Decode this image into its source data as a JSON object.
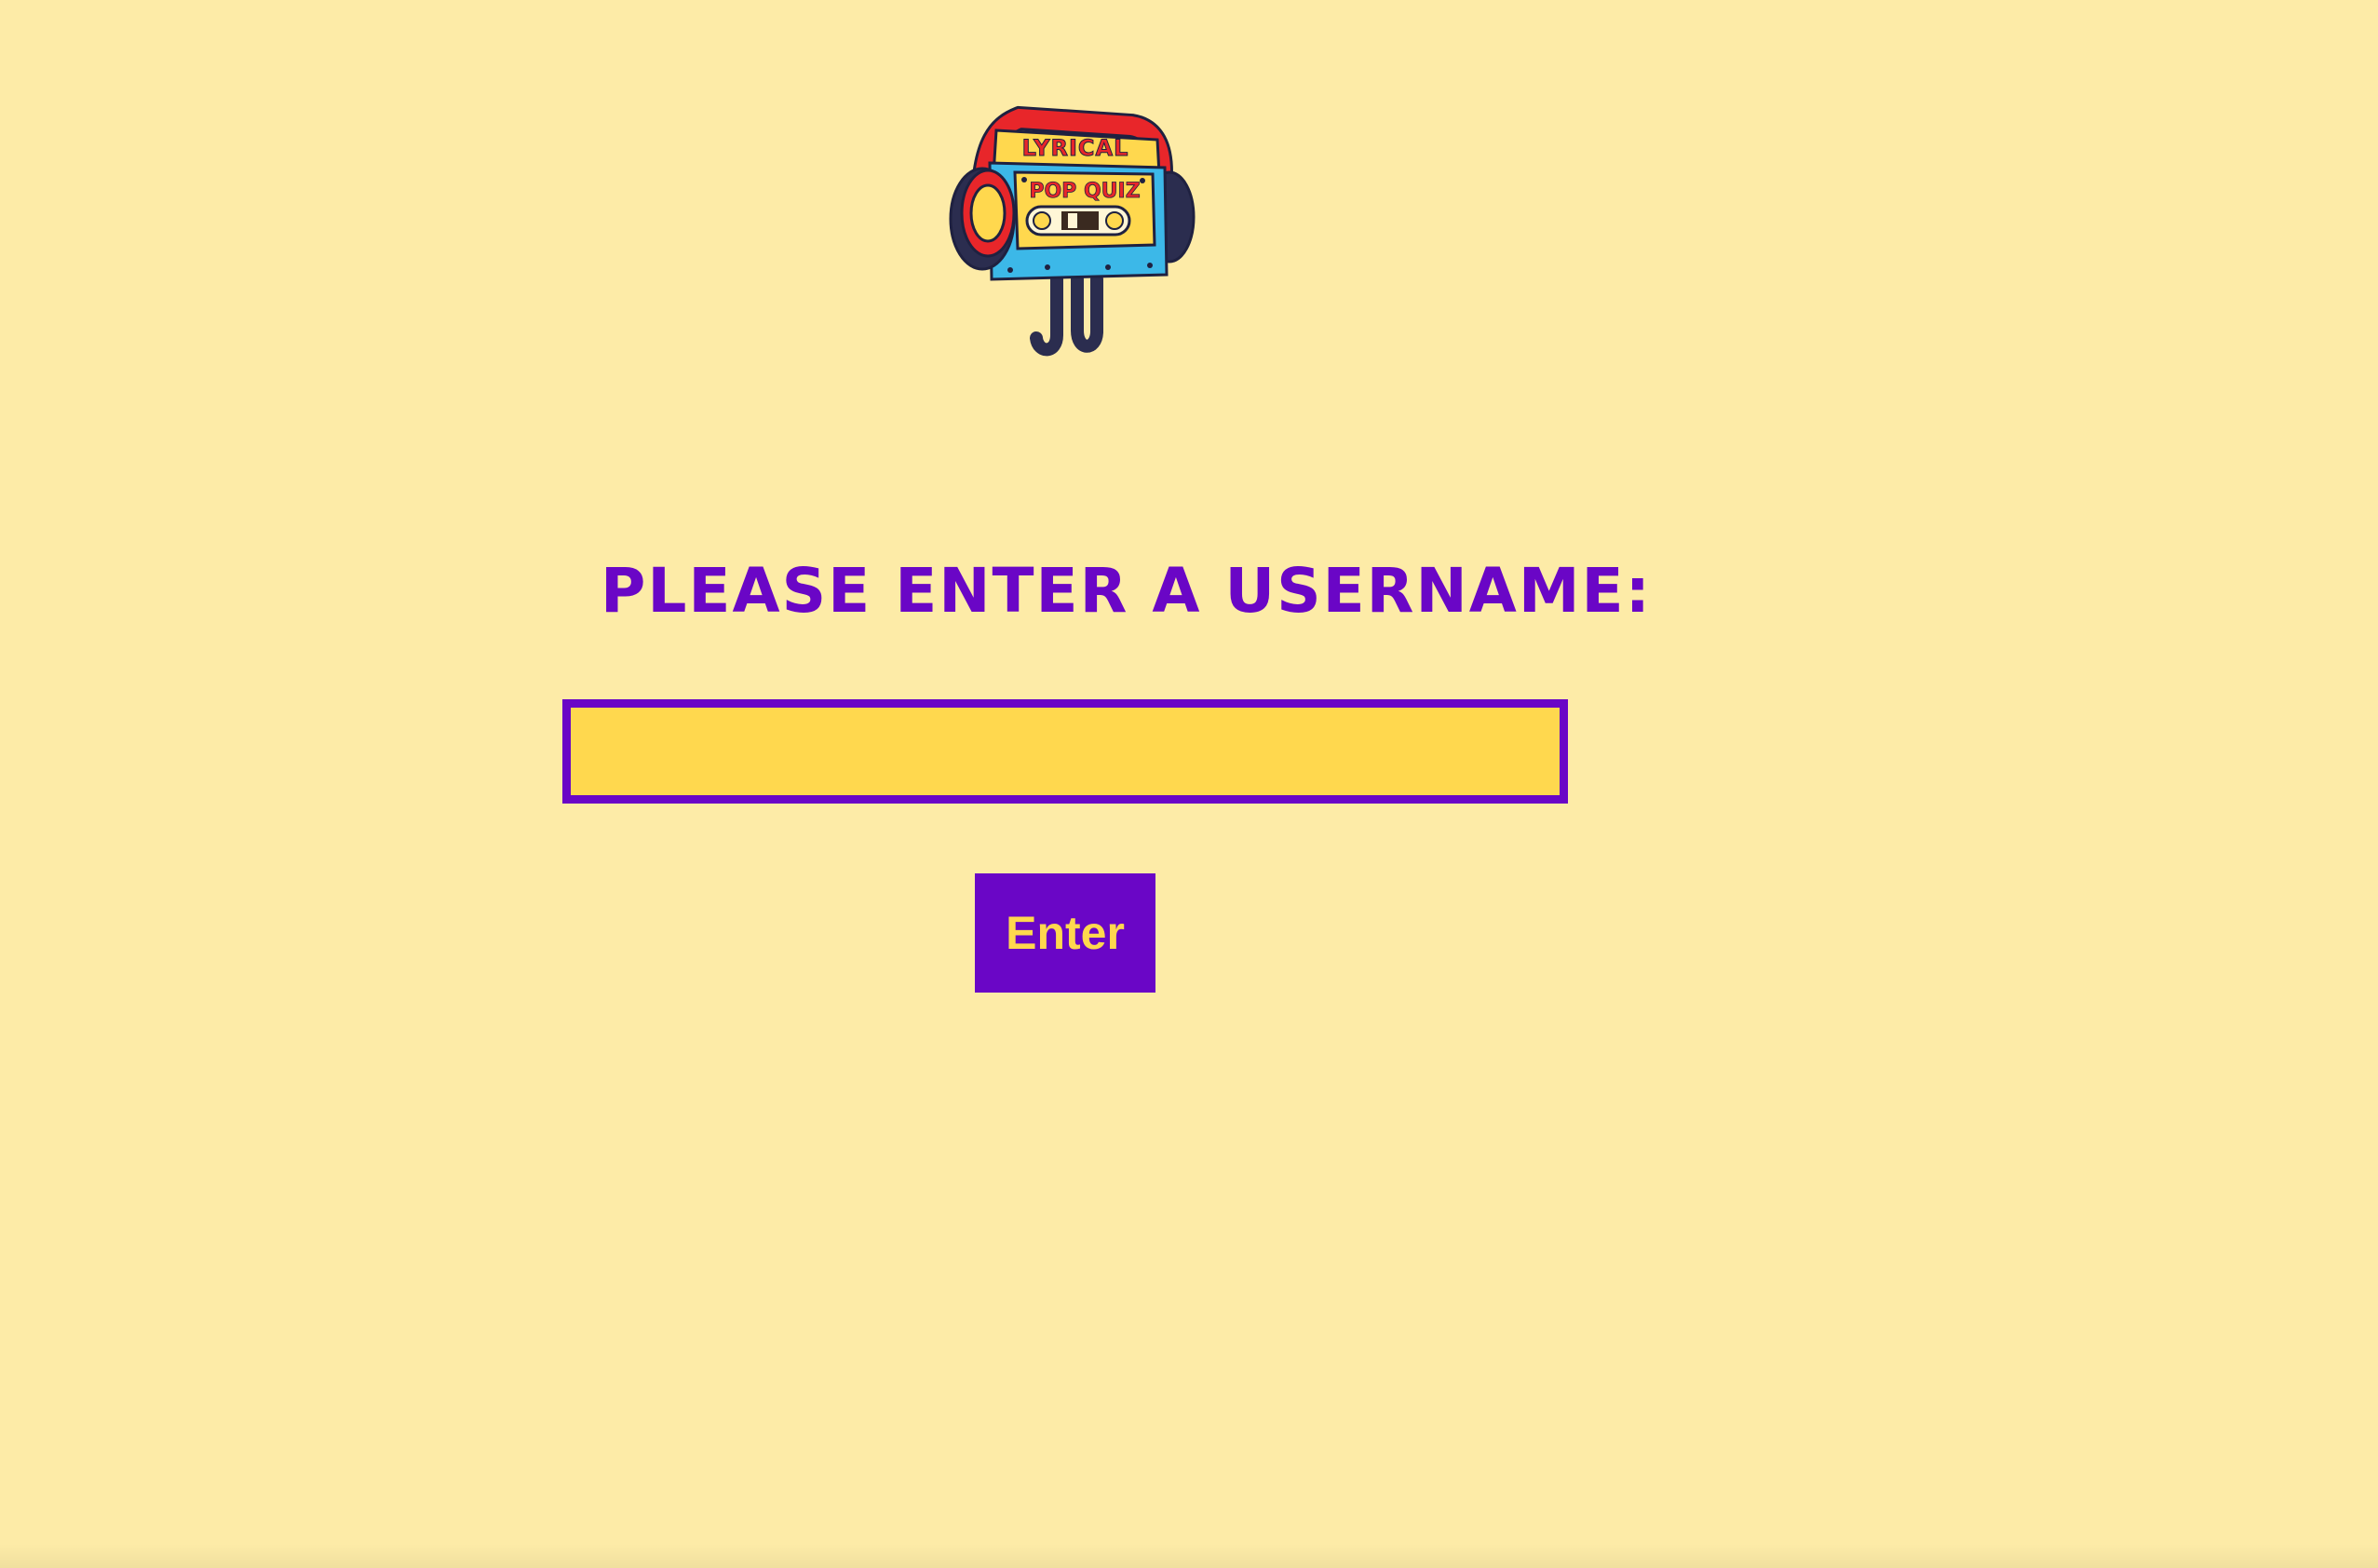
{
  "logo": {
    "line1": "LYRICAL",
    "line2": "POP QUIZ",
    "icon": "cassette-with-headphones-icon"
  },
  "prompt": {
    "text": "Please enter a username:"
  },
  "username": {
    "value": "",
    "placeholder": ""
  },
  "enter_button": {
    "label": "Enter"
  },
  "colors": {
    "background": "#fdeba7",
    "accent_purple": "#6a06c6",
    "input_yellow": "#ffd84e"
  }
}
